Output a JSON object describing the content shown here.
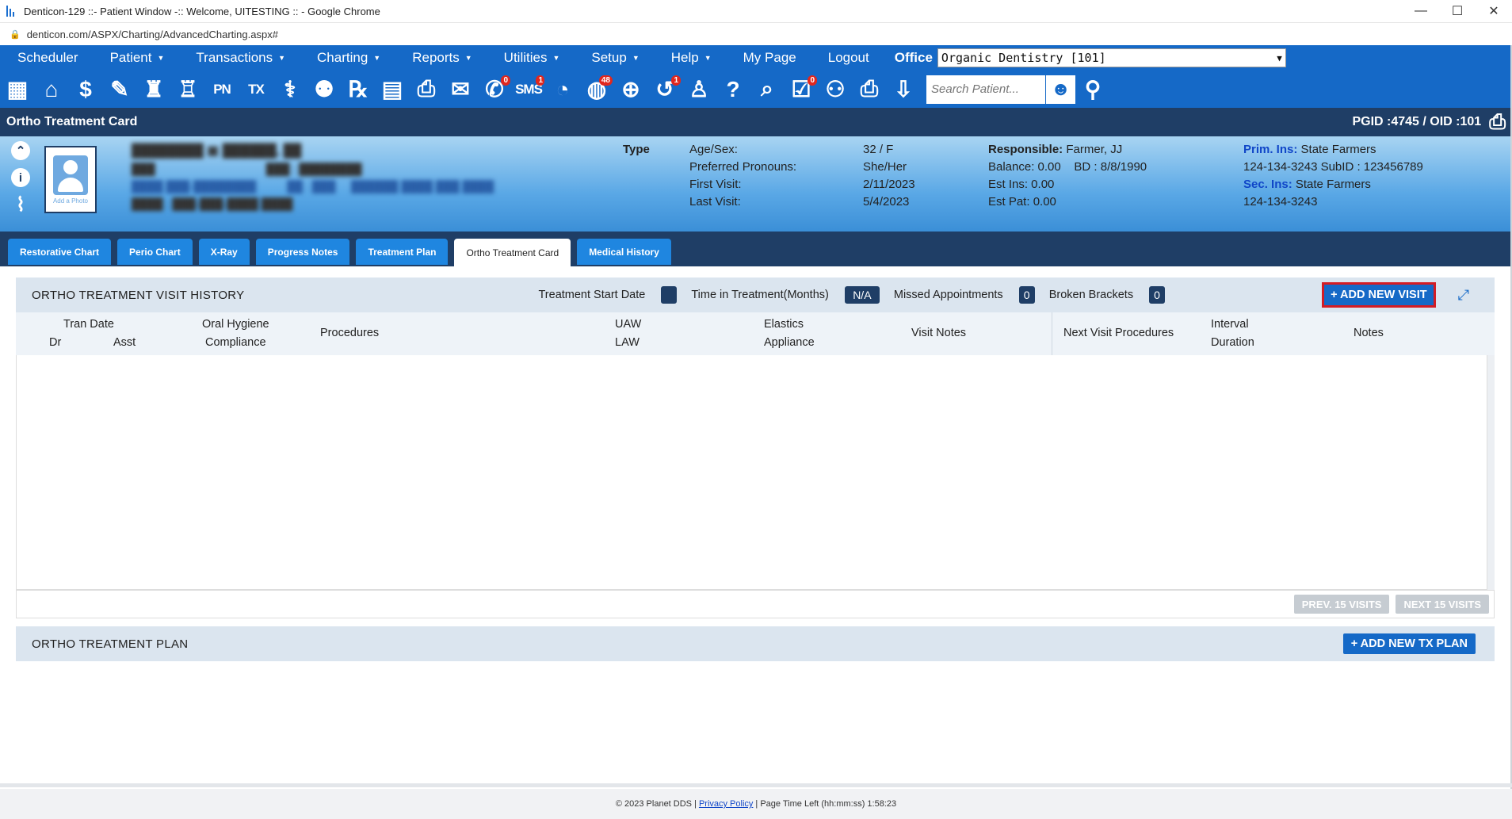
{
  "browser": {
    "title": "Denticon-129 ::- Patient Window -:: Welcome, UITESTING :: - Google Chrome",
    "url": "denticon.com/ASPX/Charting/AdvancedCharting.aspx#",
    "minimize": "—",
    "maximize": "☐",
    "close": "✕"
  },
  "menu": {
    "items": [
      "Scheduler",
      "Patient",
      "Transactions",
      "Charting",
      "Reports",
      "Utilities",
      "Setup",
      "Help",
      "My Page",
      "Logout"
    ],
    "office_label": "Office",
    "office_value": "Organic Dentistry [101]"
  },
  "toolbar": {
    "badges": {
      "sms": "1",
      "messages": "0",
      "web": "48",
      "recall": "1",
      "forms": "0"
    },
    "search_placeholder": "Search Patient..."
  },
  "card": {
    "title": "Ortho Treatment Card",
    "pgid": "PGID :4745  /  OID :101"
  },
  "patient": {
    "add_photo": "Add a Photo",
    "type_label": "Type",
    "age_sex_label": "Age/Sex:",
    "age_sex": "32 / F",
    "pronouns_label": "Preferred Pronouns:",
    "pronouns": "She/Her",
    "first_visit_label": "First Visit:",
    "first_visit": "2/11/2023",
    "last_visit_label": "Last Visit:",
    "last_visit": "5/4/2023",
    "responsible_label": "Responsible:",
    "responsible": "Farmer, JJ",
    "balance": "Balance: 0.00",
    "bd": "BD : 8/8/1990",
    "est_ins": "Est Ins:  0.00",
    "est_pat": "Est Pat: 0.00",
    "prim_ins_label": "Prim. Ins:",
    "prim_ins": "State Farmers",
    "prim_ins_ids": "124-134-3243 SubID : 123456789",
    "sec_ins_label": "Sec. Ins:",
    "sec_ins": "State Farmers",
    "sec_ins_ids": "124-134-3243"
  },
  "tabs": [
    "Restorative Chart",
    "Perio Chart",
    "X-Ray",
    "Progress Notes",
    "Treatment Plan",
    "Ortho Treatment Card",
    "Medical History"
  ],
  "active_tab": "Ortho Treatment Card",
  "visit_history": {
    "title": "ORTHO TREATMENT VISIT HISTORY",
    "start_date_label": "Treatment Start Date",
    "start_date_value": "",
    "time_label": "Time in Treatment(Months)",
    "time_value": "N/A",
    "missed_label": "Missed Appointments",
    "missed_value": "0",
    "broken_label": "Broken Brackets",
    "broken_value": "0",
    "add_visit": "+ ADD NEW VISIT",
    "columns": {
      "tran_date": "Tran Date",
      "dr": "Dr",
      "asst": "Asst",
      "oral_hygiene": "Oral Hygiene",
      "compliance": "Compliance",
      "procedures": "Procedures",
      "uaw": "UAW",
      "law": "LAW",
      "elastics": "Elastics",
      "appliance": "Appliance",
      "visit_notes": "Visit Notes",
      "next_visit_procedures": "Next Visit Procedures",
      "interval": "Interval",
      "duration": "Duration",
      "notes": "Notes"
    },
    "prev": "PREV. 15 VISITS",
    "next": "NEXT 15 VISITS"
  },
  "tx_plan": {
    "title": "ORTHO TREATMENT PLAN",
    "add": "+ ADD NEW TX PLAN"
  },
  "footer": {
    "copyright": "© 2023 Planet DDS |",
    "privacy": "Privacy Policy",
    "time_left": "| Page Time Left (hh:mm:ss) 1:58:23"
  }
}
